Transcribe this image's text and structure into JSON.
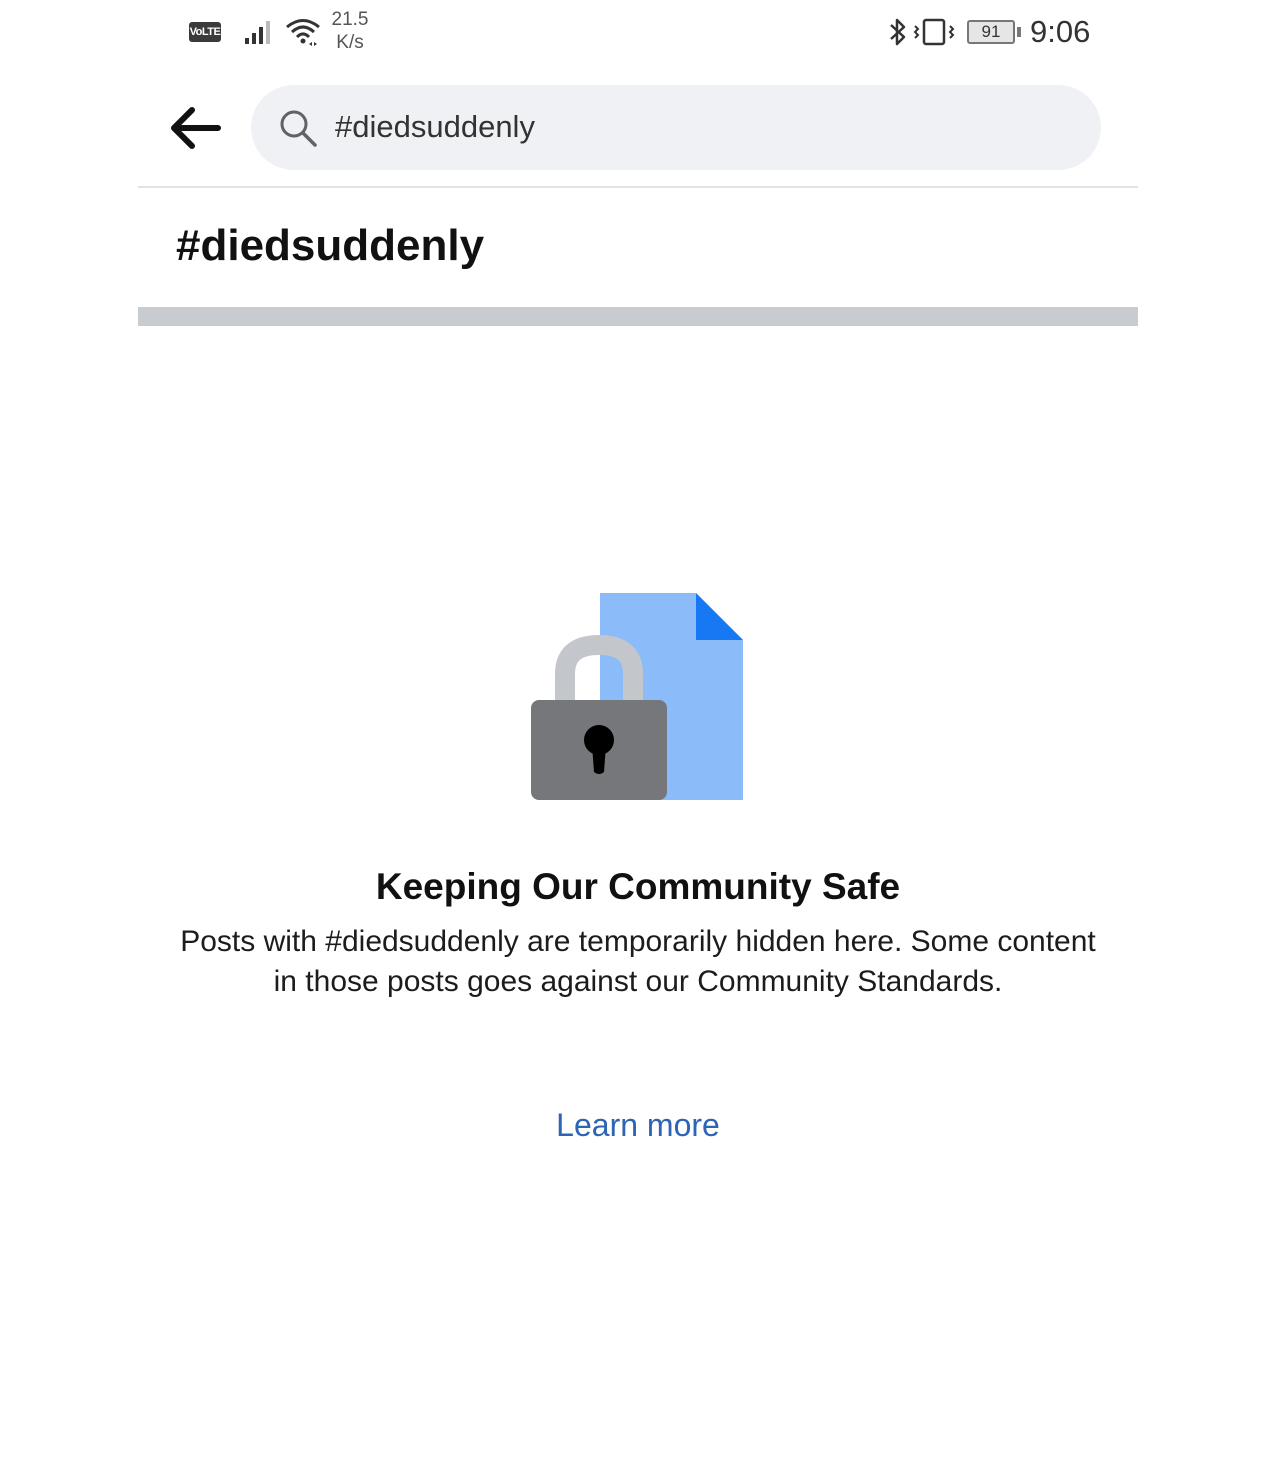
{
  "status_bar": {
    "volte_label": "VoLTE",
    "net_speed_value": "21.5",
    "net_speed_unit": "K/s",
    "battery_level": "91",
    "time": "9:06",
    "icons": [
      "signal-icon",
      "wifi-icon",
      "bluetooth-icon",
      "vibrate-icon",
      "battery-icon"
    ]
  },
  "header": {
    "back_icon": "arrow-left-icon",
    "search": {
      "icon": "search-icon",
      "value": "#diedsuddenly"
    }
  },
  "hashtag": {
    "title": "#diedsuddenly"
  },
  "notice": {
    "illustration": "locked-document-icon",
    "title": "Keeping Our Community Safe",
    "body": "Posts with #diedsuddenly are temporarily hidden here. Some content in those posts goes against our Community Standards.",
    "link_label": "Learn more"
  },
  "colors": {
    "link": "#2d64b4",
    "search_bg": "#eff1f4",
    "separator": "#c8cbcf",
    "doc_blue": "#8bbcf9",
    "doc_fold": "#1877f2",
    "lock_body": "#75777b",
    "lock_shackle": "#c3c6cb"
  }
}
